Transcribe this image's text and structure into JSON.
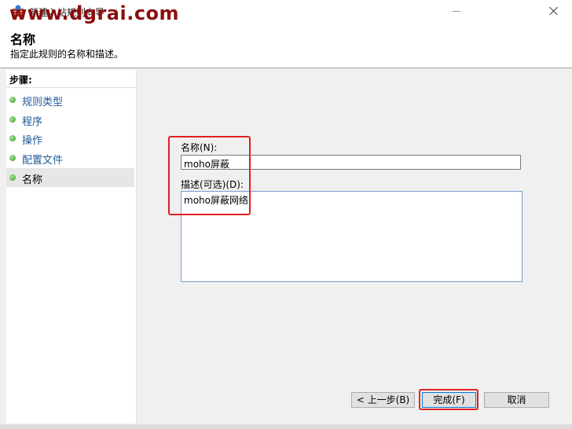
{
  "window": {
    "title": "新建入站规则向导",
    "icon": "firewall-icon"
  },
  "watermark": "www.dgrai.com",
  "header": {
    "title": "名称",
    "subtitle": "指定此规则的名称和描述。"
  },
  "sidebar": {
    "heading": "步骤:",
    "items": [
      {
        "label": "规则类型"
      },
      {
        "label": "程序"
      },
      {
        "label": "操作"
      },
      {
        "label": "配置文件"
      },
      {
        "label": "名称"
      }
    ],
    "active_index": 4
  },
  "form": {
    "name_label": "名称(N):",
    "name_value": "moho屏蔽",
    "desc_label": "描述(可选)(D):",
    "desc_value": "moho屏蔽网络"
  },
  "buttons": {
    "back": "< 上一步(B)",
    "finish": "完成(F)",
    "cancel": "取消"
  },
  "colors": {
    "highlight": "#e02020",
    "watermark": "#8b0d0d",
    "link": "#1e5a9a"
  }
}
